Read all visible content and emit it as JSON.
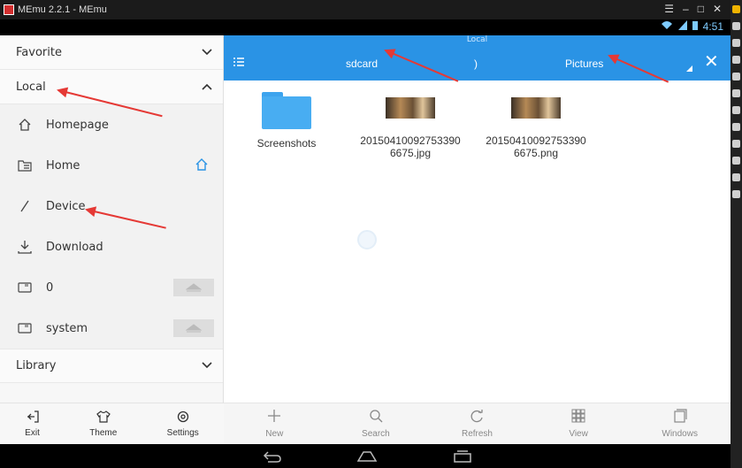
{
  "window": {
    "title": "MEmu 2.2.1 - MEmu"
  },
  "status": {
    "time": "4:51",
    "notification_text": "Local"
  },
  "drawer": {
    "sections": [
      {
        "label": "Favorite",
        "expanded": false
      },
      {
        "label": "Local",
        "expanded": true
      },
      {
        "label": "Library",
        "expanded": false
      }
    ],
    "local_items": [
      {
        "label": "Homepage",
        "icon": "home-outline-icon"
      },
      {
        "label": "Home",
        "icon": "folder-list-icon"
      },
      {
        "label": "Device",
        "icon": "slash-icon"
      },
      {
        "label": "Download",
        "icon": "download-icon"
      },
      {
        "label": "0",
        "icon": "sdcard-icon"
      },
      {
        "label": "system",
        "icon": "sdcard-icon"
      }
    ],
    "bottom": [
      {
        "label": "Exit",
        "icon": "exit-icon"
      },
      {
        "label": "Theme",
        "icon": "shirt-icon"
      },
      {
        "label": "Settings",
        "icon": "gear-icon"
      }
    ]
  },
  "toolbar": {
    "breadcrumb": [
      "sdcard",
      "Pictures"
    ],
    "separator": ")"
  },
  "files": [
    {
      "name": "Screenshots",
      "type": "folder"
    },
    {
      "name_line1": "20150410092753390",
      "name_line2": "6675.jpg",
      "type": "image"
    },
    {
      "name_line1": "20150410092753390",
      "name_line2": "6675.png",
      "type": "image"
    }
  ],
  "bottom_tools": [
    {
      "label": "New",
      "icon": "plus-icon"
    },
    {
      "label": "Search",
      "icon": "search-icon"
    },
    {
      "label": "Refresh",
      "icon": "refresh-icon"
    },
    {
      "label": "View",
      "icon": "grid-icon"
    },
    {
      "label": "Windows",
      "icon": "windows-icon"
    }
  ],
  "colors": {
    "accent": "#2a93e5",
    "annotation": "#e53935",
    "folder": "#48adf2"
  }
}
